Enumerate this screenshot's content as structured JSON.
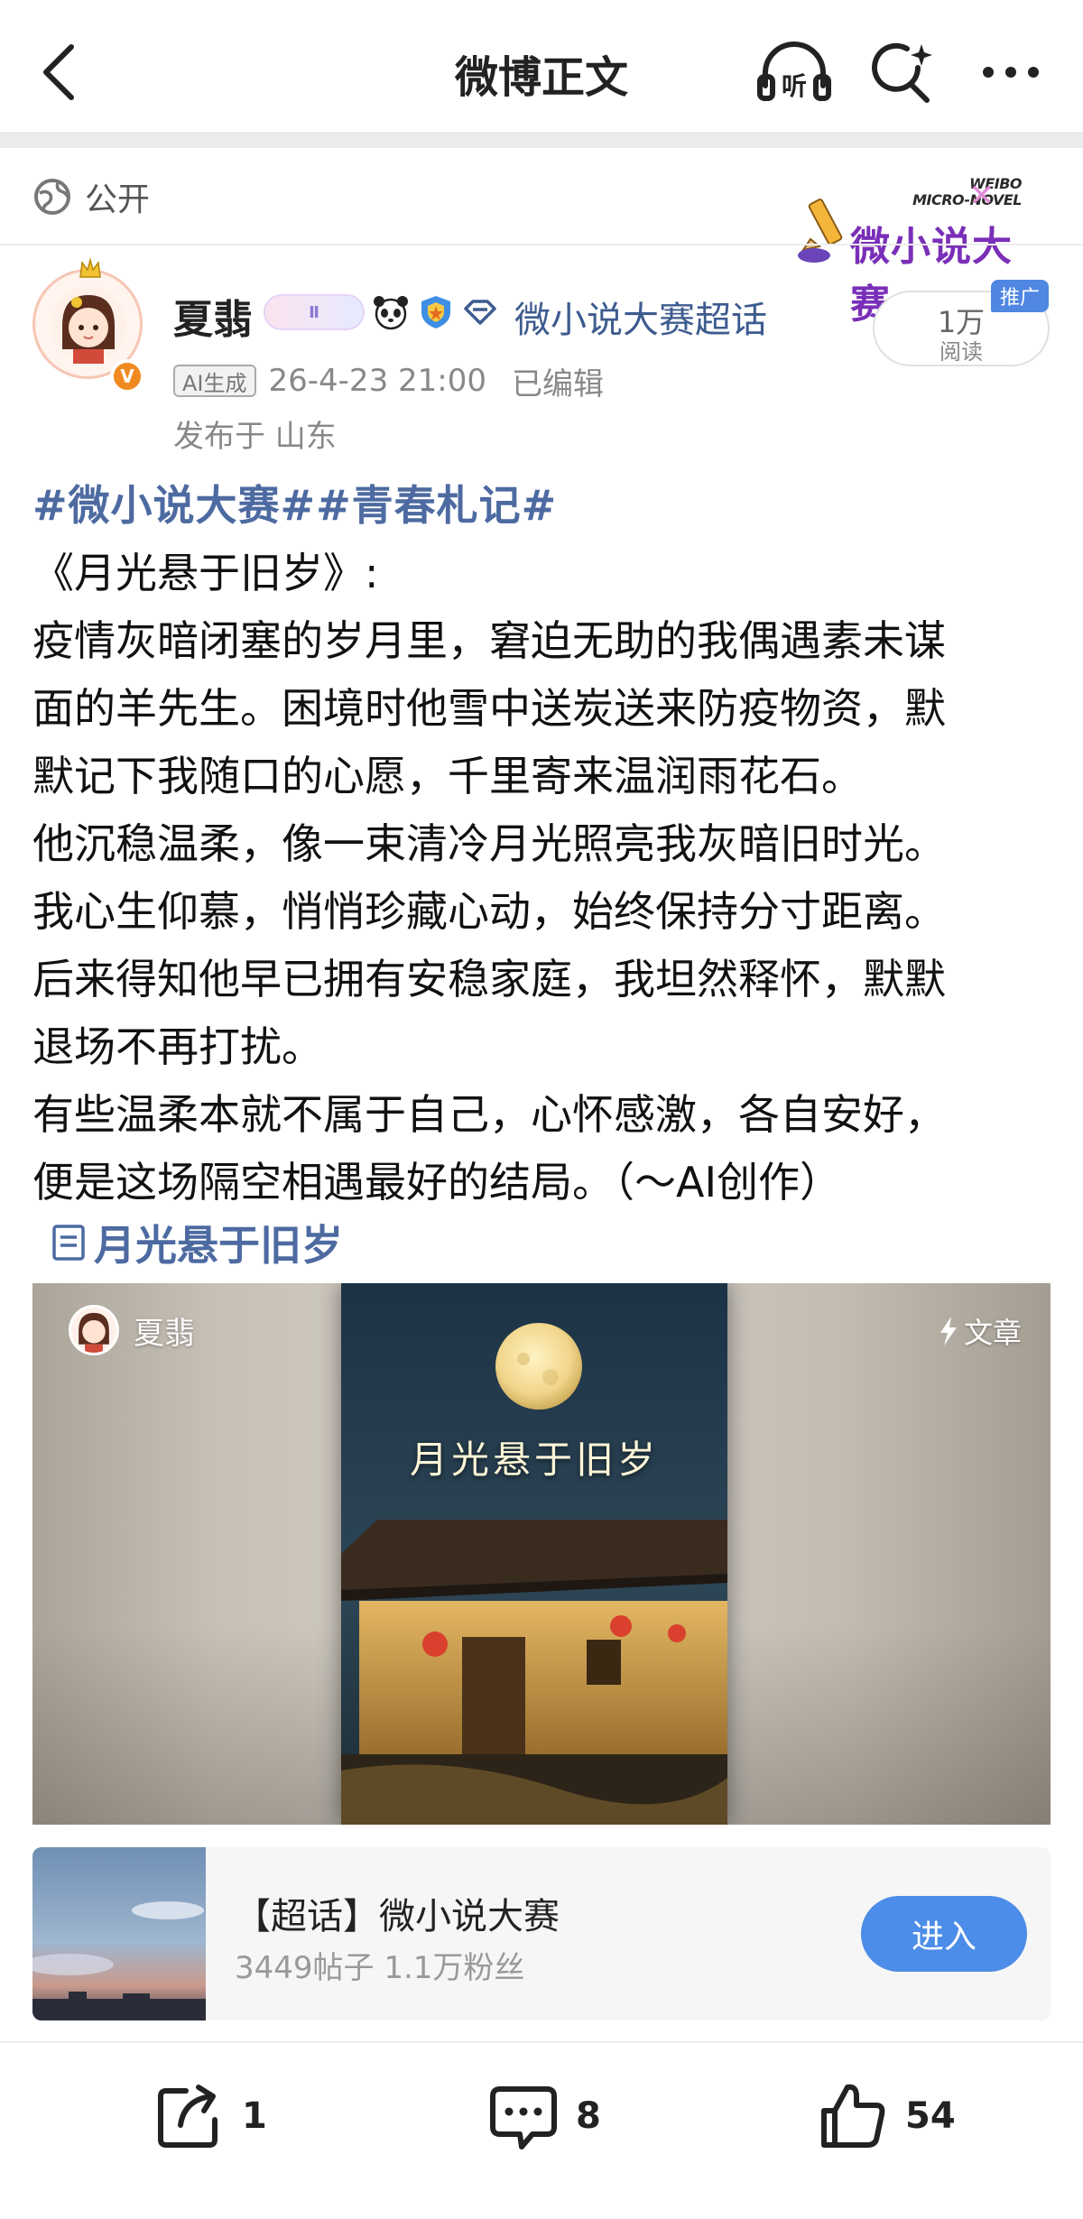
{
  "nav": {
    "title": "微博正文",
    "back_icon": "chevron-left-icon",
    "listen_label": "听",
    "search_icon": "search-sparkle-icon",
    "more_icon": "ellipsis-icon"
  },
  "visibility": {
    "label": "公开",
    "icon": "globe-icon"
  },
  "contest_badge": {
    "en_line1": "WEIBO",
    "en_line2": "MICRO-NOVEL",
    "cn": "微小说大赛"
  },
  "author": {
    "name": "夏翡",
    "badge_text": "Ⅱ",
    "verified_mark": "V",
    "supertopic": "微小说大赛超话",
    "ai_tag": "AI生成",
    "time": "26-4-23 21:00",
    "edited": "已编辑",
    "location": "发布于 山东"
  },
  "reads": {
    "count": "1万",
    "label": "阅读",
    "promo": "推广"
  },
  "post": {
    "topics": "#微小说大赛##青春札记#",
    "lines": [
      "《月光悬于旧岁》:",
      "疫情灰暗闭塞的岁月里，窘迫无助的我偶遇素未谋",
      "面的羊先生。困境时他雪中送炭送来防疫物资，默",
      "默记下我随口的心愿，千里寄来温润雨花石。",
      "他沉稳温柔，像一束清冷月光照亮我灰暗旧时光。",
      "我心生仰慕，悄悄珍藏心动，始终保持分寸距离。",
      "后来得知他早已拥有安稳家庭，我坦然释怀，默默",
      "退场不再打扰。",
      "有些温柔本就不属于自己，心怀感激，各自安好，",
      "便是这场隔空相遇最好的结局。（～AI创作）"
    ],
    "article_link": "月光悬于旧岁"
  },
  "article_card": {
    "author": "夏翡",
    "tag": "文章",
    "book_title": "月光悬于旧岁"
  },
  "topic_card": {
    "name": "【超话】微小说大赛",
    "stats": "3449帖子 1.1万粉丝",
    "join": "进入"
  },
  "actions": {
    "reposts": "1",
    "comments": "8",
    "likes": "54"
  },
  "colors": {
    "link": "#4d6aa1",
    "join_button": "#4b8de8",
    "promo": "#4f87e3",
    "verified": "#f08a20"
  }
}
